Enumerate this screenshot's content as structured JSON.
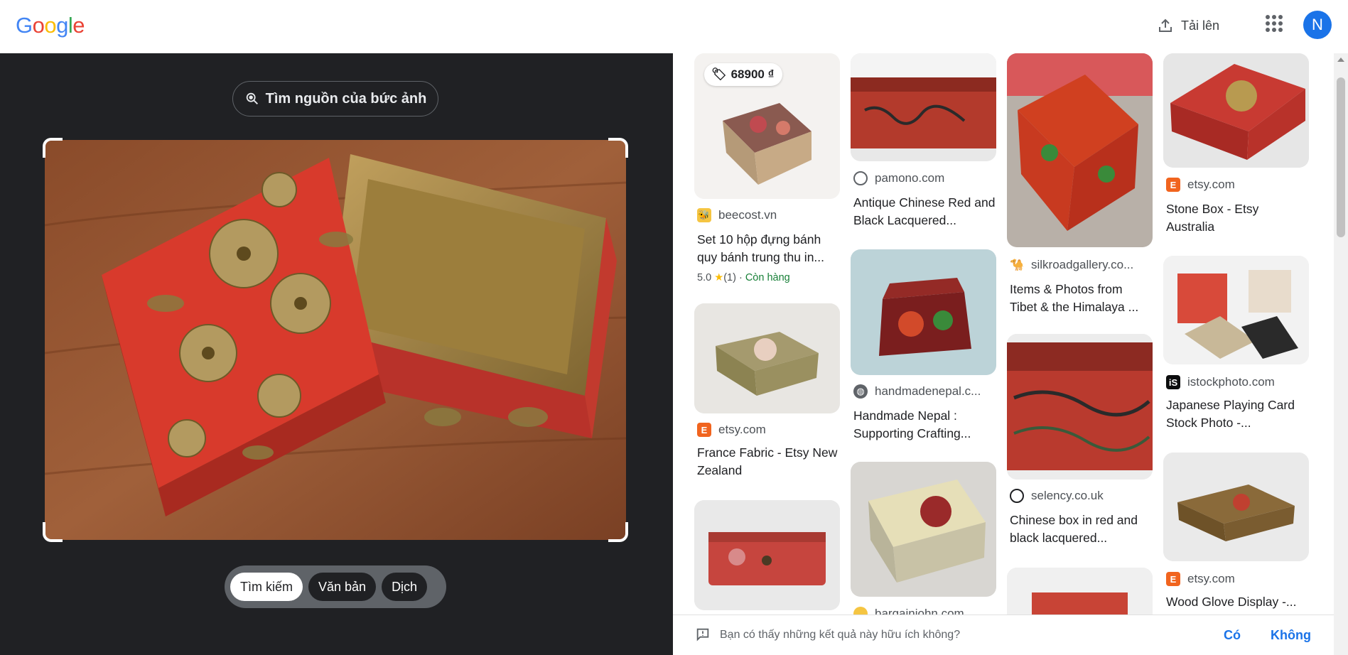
{
  "header": {
    "logo_text": "Google",
    "upload_label": "Tải lên",
    "avatar_letter": "N"
  },
  "left": {
    "source_button": "Tìm nguồn của bức ảnh",
    "modes": [
      "Tìm kiếm",
      "Văn bản",
      "Dịch"
    ],
    "active_mode": "Tìm kiếm"
  },
  "results": {
    "col1": [
      {
        "price": "68900 ₫",
        "source": "beecost.vn",
        "title": "Set 10 hộp đựng bánh quy bánh trung thu in...",
        "rating": "5.0",
        "reviews": "(1)",
        "stock": "Còn hàng"
      },
      {
        "source": "etsy.com",
        "title": "France Fabric - Etsy New Zealand"
      },
      {
        "source": "",
        "title": ""
      }
    ],
    "col2": [
      {
        "source": "pamono.com",
        "title": "Antique Chinese Red and Black Lacquered..."
      },
      {
        "source": "handmadenepal.c...",
        "title": "Handmade Nepal : Supporting Crafting..."
      },
      {
        "source": "bargainjohn.com",
        "title": ""
      }
    ],
    "col3": [
      {
        "source": "silkroadgallery.co...",
        "title": "Items & Photos from Tibet & the Himalaya ..."
      },
      {
        "source": "selency.co.uk",
        "title": "Chinese box in red and black lacquered..."
      },
      {
        "source": "",
        "title": ""
      }
    ],
    "col4": [
      {
        "source": "etsy.com",
        "title": "Stone Box - Etsy Australia"
      },
      {
        "source": "istockphoto.com",
        "title": "Japanese Playing Card Stock Photo -..."
      },
      {
        "source": "etsy.com",
        "title": "Wood Glove Display -..."
      }
    ]
  },
  "feedback": {
    "question": "Bạn có thấy những kết quả này hữu ích không?",
    "yes": "Có",
    "no": "Không"
  },
  "colors": {
    "accent": "#1a73e8",
    "dark_panel": "#202124",
    "box_red": "#d83a2c",
    "box_gold": "#a88a4a"
  }
}
